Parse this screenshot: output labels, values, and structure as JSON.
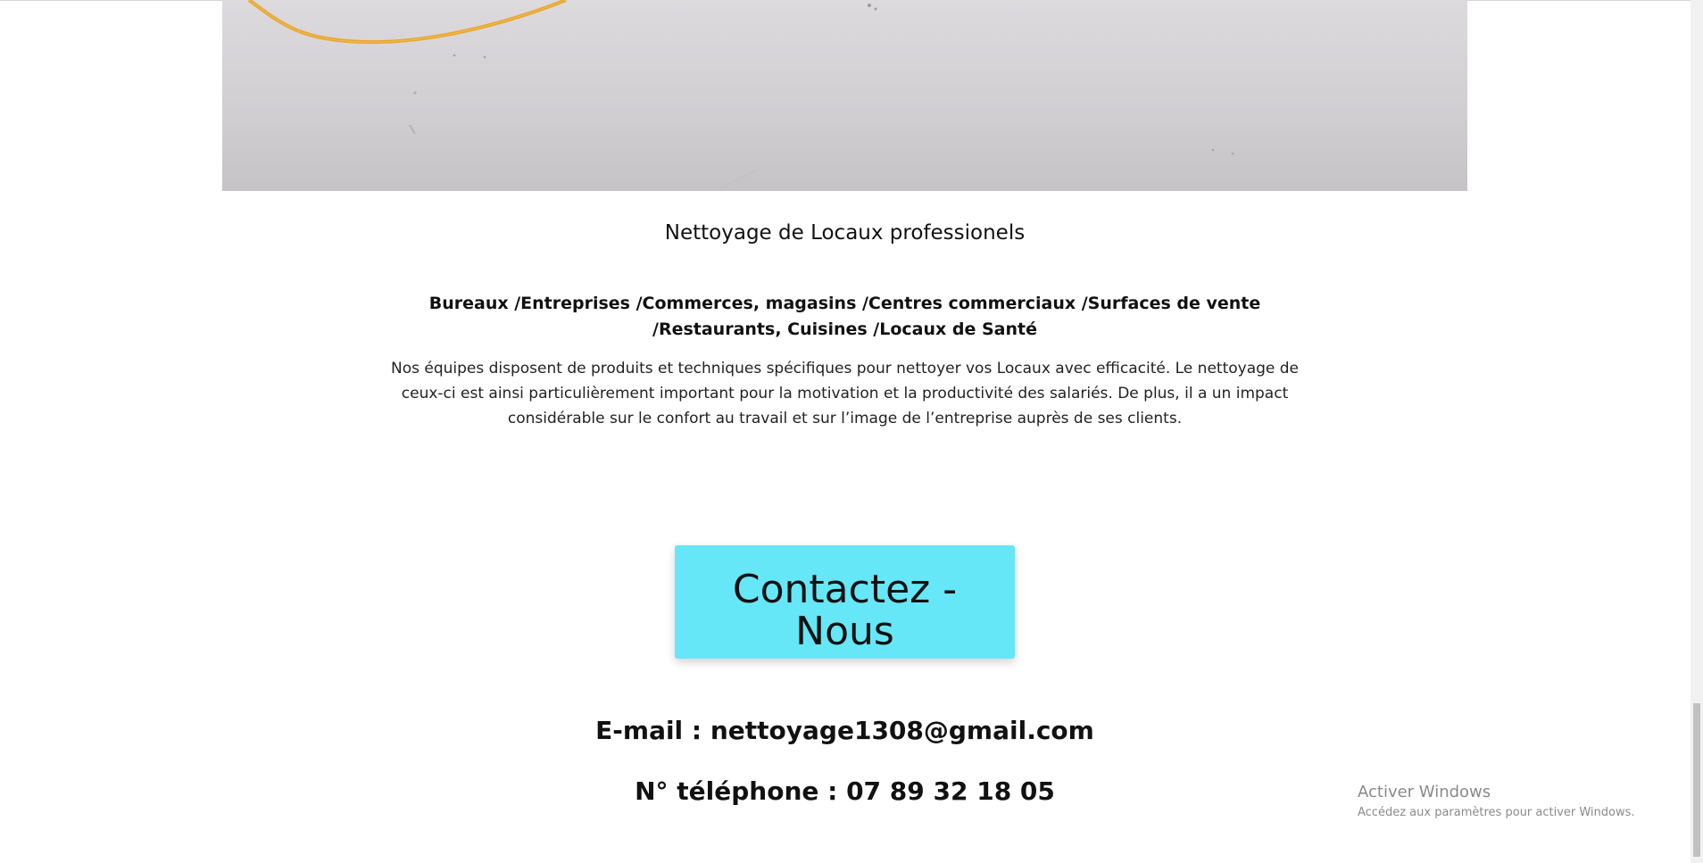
{
  "section": {
    "title": "Nettoyage de Locaux professionels",
    "services": "Bureaux /Entreprises /Commerces, magasins /Centres commerciaux /Surfaces de vente /Restaurants, Cuisines /Locaux de Santé",
    "description": "Nos équipes disposent de produits et techniques spécifiques pour nettoyer vos Locaux avec efficacité. Le nettoyage de ceux-ci est ainsi particulièrement important pour la motivation et la productivité des salariés. De plus, il a un impact considérable sur le confort au travail et sur l’image de l’entreprise auprès de ses clients."
  },
  "contact": {
    "button_label": "Contactez - Nous",
    "email": "E-mail : nettoyage1308@gmail.com",
    "phone": "N° téléphone : 07 89 32 18 05"
  },
  "os_watermark": {
    "title": "Activer Windows",
    "subtitle": "Accédez aux paramètres pour activer Windows."
  },
  "colors": {
    "button_background": "#65e7f7",
    "text": "#111111",
    "cable": "#f0a928"
  }
}
